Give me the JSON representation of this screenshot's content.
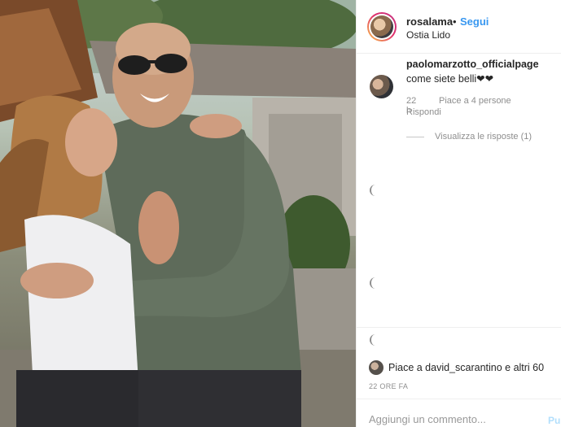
{
  "post": {
    "username": "rosalama",
    "separator": "•",
    "follow_label": "Segui",
    "location": "Ostia Lido"
  },
  "comment": {
    "username": "paolomarzotto_officialpage",
    "text": "come siete belli❤❤",
    "time": "22 h",
    "likes": "Piace a 4 persone",
    "reply_label": "Rispondi",
    "view_replies": "Visualizza le risposte (1)"
  },
  "likes": {
    "text": "Piace a david_scarantino e altri 60"
  },
  "post_time": "22 ORE FA",
  "add_comment": {
    "placeholder": "Aggiungi un commento...",
    "publish_label": "Pu"
  },
  "colors": {
    "accent": "#3897f0",
    "muted": "#8e8e8e",
    "text": "#262626",
    "publish_disabled": "#b2dffc"
  }
}
